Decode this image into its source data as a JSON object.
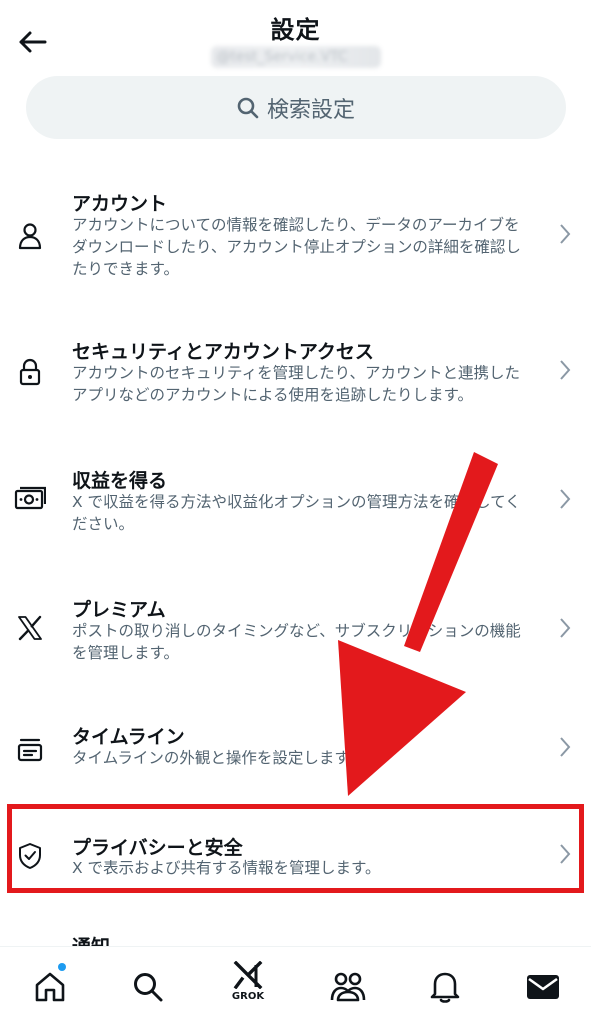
{
  "header": {
    "title": "設定",
    "handle": "@test_Service.VTC"
  },
  "search": {
    "placeholder": "検索設定"
  },
  "items": [
    {
      "title": "アカウント",
      "desc": "アカウントについての情報を確認したり、データのアーカイブをダウンロードしたり、アカウント停止オプションの詳細を確認したりできます。",
      "icon": "person-icon"
    },
    {
      "title": "セキュリティとアカウントアクセス",
      "desc": "アカウントのセキュリティを管理したり、アカウントと連携したアプリなどのアカウントによる使用を追跡したりします。",
      "icon": "lock-icon"
    },
    {
      "title": "収益を得る",
      "desc": "X で収益を得る方法や収益化オプションの管理方法を確認してください。",
      "icon": "money-icon"
    },
    {
      "title": "プレミアム",
      "desc": "ポストの取り消しのタイミングなど、サブスクリプションの機能を管理します。",
      "icon": "x-logo-icon"
    },
    {
      "title": "タイムライン",
      "desc": "タイムラインの外観と操作を設定します。",
      "icon": "timeline-icon"
    },
    {
      "title": "プライバシーと安全",
      "desc": "X で表示および共有する情報を管理します。",
      "icon": "shield-icon"
    }
  ],
  "partial_item": {
    "title": "通知"
  },
  "bottom_nav": {
    "grok_label": "GROK",
    "items": [
      "home-icon",
      "search-icon",
      "grok-icon",
      "communities-icon",
      "bell-icon",
      "mail-icon"
    ]
  },
  "colors": {
    "highlight": "#e3191c",
    "text_primary": "#0f1419",
    "text_secondary": "#536471",
    "search_bg": "#eff3f4",
    "badge": "#1d9bf0"
  }
}
